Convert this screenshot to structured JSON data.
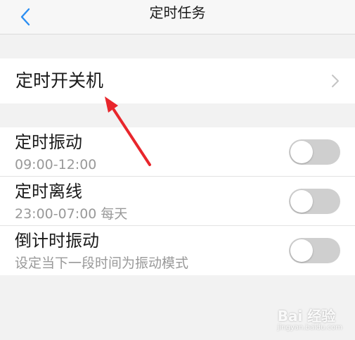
{
  "header": {
    "title": "定时任务",
    "back_icon": "chevron-left-icon",
    "back_color": "#2b8ef2"
  },
  "power_schedule": {
    "label": "定时开关机",
    "chevron_icon": "chevron-right-icon"
  },
  "toggles": [
    {
      "label": "定时振动",
      "subtitle": "09:00-12:00",
      "on": false
    },
    {
      "label": "定时离线",
      "subtitle": "23:00-07:00 每天",
      "on": false
    },
    {
      "label": "倒计时振动",
      "subtitle": "设定当下一段时间为振动模式",
      "on": false
    }
  ],
  "annotation": {
    "arrow_color": "#e8262c"
  },
  "watermark": {
    "text": "Bai 经验",
    "subtext": "jingyan.baidu.com"
  }
}
